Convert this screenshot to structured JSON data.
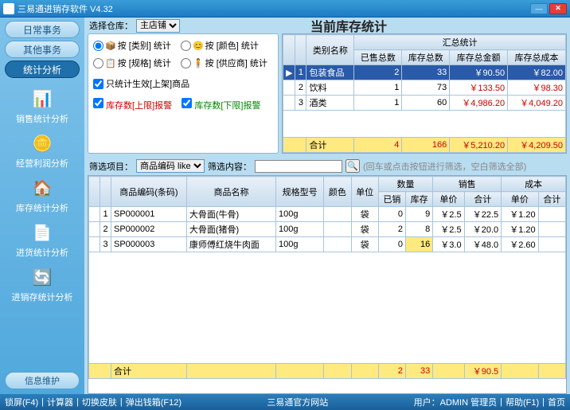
{
  "window": {
    "title": "三易通进销存软件  V4.32"
  },
  "toolbar": {
    "select_warehouse_label": "选择仓库：",
    "warehouse_value": "主店铺"
  },
  "page_title": "当前库存统计",
  "nav": {
    "daily": "日常事务",
    "other": "其他事务",
    "stats": "统计分析",
    "info": "信息维护"
  },
  "side_items": [
    "销售统计分析",
    "经营利润分析",
    "库存统计分析",
    "进货统计分析",
    "进销存统计分析"
  ],
  "options": {
    "by_category": "按 [类别] 统计",
    "by_color": "按 [颜色] 统计",
    "by_spec": "按 [规格] 统计",
    "by_supplier": "按 [供应商] 统计",
    "only_onshelf": "只统计生效[上架]商品",
    "upper_warn": "库存数[上限]报警",
    "lower_warn": "库存数[下限]报警"
  },
  "summary": {
    "headers": {
      "category": "类别名称",
      "summary": "汇总统计",
      "sold_qty": "已售总数",
      "stock_qty": "库存总数",
      "stock_amt": "库存总金额",
      "stock_cost": "库存总成本"
    },
    "rows": [
      {
        "idx": 1,
        "name": "包装食品",
        "sold": 2,
        "stock": 33,
        "amt": "￥90.50",
        "cost": "￥82.00",
        "hl": true
      },
      {
        "idx": 2,
        "name": "饮料",
        "sold": 1,
        "stock": 73,
        "amt": "￥133.50",
        "cost": "￥98.30"
      },
      {
        "idx": 3,
        "name": "酒类",
        "sold": 1,
        "stock": 60,
        "amt": "￥4,986.20",
        "cost": "￥4,049.20"
      }
    ],
    "total_label": "合计",
    "total": {
      "sold": 4,
      "stock": 166,
      "amt": "￥5,210.20",
      "cost": "￥4,209.50"
    }
  },
  "filter": {
    "label": "筛选项目：",
    "field": "商品编码 like",
    "content_label": "筛选内容：",
    "hint": "(回车或点击按钮进行筛选，空白筛选全部)"
  },
  "detail": {
    "headers": {
      "code": "商品编码(条码)",
      "name": "商品名称",
      "spec": "规格型号",
      "color": "颜色",
      "unit": "单位",
      "qty": "数量",
      "sold": "已销",
      "stock": "库存",
      "sale": "销售",
      "price": "单价",
      "total": "合计",
      "cost": "成本"
    },
    "rows": [
      {
        "idx": 1,
        "code": "SP000001",
        "name": "大骨面(牛骨)",
        "spec": "100g",
        "unit": "袋",
        "sold": 0,
        "stock": 9,
        "sprice": "￥2.5",
        "stotal": "￥22.5",
        "cprice": "￥1.20",
        "ctotal": ""
      },
      {
        "idx": 2,
        "code": "SP000002",
        "name": "大骨面(猪骨)",
        "spec": "100g",
        "unit": "袋",
        "sold": 2,
        "stock": 8,
        "sprice": "￥2.5",
        "stotal": "￥20.0",
        "cprice": "￥1.20",
        "ctotal": ""
      },
      {
        "idx": 3,
        "code": "SP000003",
        "name": "康师傅红烧牛肉面",
        "spec": "100g",
        "unit": "袋",
        "sold": 0,
        "stock": 16,
        "sprice": "￥3.0",
        "stotal": "￥48.0",
        "cprice": "￥2.60",
        "ctotal": "",
        "stock_hl": true
      }
    ],
    "total": {
      "label": "合计",
      "sold": 2,
      "stock": 33,
      "stotal": "￥90.5"
    }
  },
  "footer": {
    "lock": "锁屏(F4)",
    "calc": "计算器",
    "skin": "切换皮肤",
    "cash": "弹出钱箱(F12)",
    "site": "三易通官方网站",
    "user_label": "用户：",
    "user": "ADMIN 管理员",
    "help": "帮助(F1)",
    "home": "首页"
  }
}
